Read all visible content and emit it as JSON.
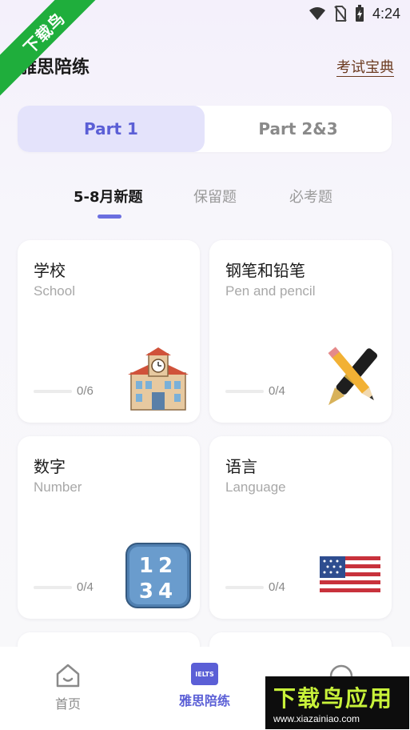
{
  "status_bar": {
    "time": "4:24"
  },
  "ribbon": {
    "text": "下载鸟"
  },
  "header": {
    "title": "雅思陪练",
    "dictionary_link": "考试宝典"
  },
  "part_tabs": [
    {
      "label": "Part 1",
      "active": true
    },
    {
      "label": "Part 2&3",
      "active": false
    }
  ],
  "sub_tabs": [
    {
      "label": "5-8月新题",
      "active": true
    },
    {
      "label": "保留题",
      "active": false
    },
    {
      "label": "必考题",
      "active": false
    }
  ],
  "topics": [
    {
      "title": "学校",
      "subtitle": "School",
      "progress": "0/6",
      "progress_fraction": 0,
      "icon": "school-building-icon"
    },
    {
      "title": "钢笔和铅笔",
      "subtitle": "Pen and pencil",
      "progress": "0/4",
      "progress_fraction": 0,
      "icon": "pen-and-pencil-icon"
    },
    {
      "title": "数字",
      "subtitle": "Number",
      "progress": "0/4",
      "progress_fraction": 0,
      "icon": "numbers-1234-icon"
    },
    {
      "title": "语言",
      "subtitle": "Language",
      "progress": "0/4",
      "progress_fraction": 0,
      "icon": "us-flag-icon"
    }
  ],
  "bottom_nav": [
    {
      "label": "首页",
      "icon": "home-icon",
      "active": false
    },
    {
      "label": "雅思陪练",
      "icon": "ielts-icon",
      "badge": "IELTS",
      "active": true
    },
    {
      "label": "",
      "icon": "profile-icon",
      "active": false
    }
  ],
  "watermark": {
    "brand": "下载鸟应用",
    "url": "www.xiazainiao.com"
  },
  "colors": {
    "accent": "#5b5fd6",
    "active_tab_bg": "#e4e3fb",
    "ribbon": "#1fae3c"
  }
}
